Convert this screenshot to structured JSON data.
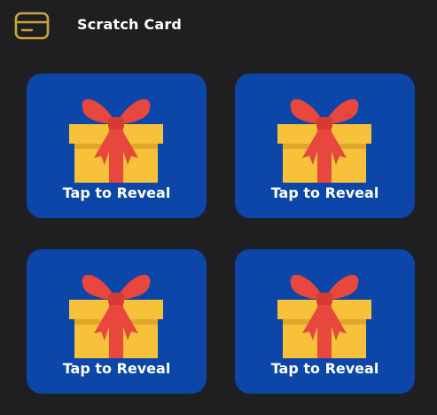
{
  "header": {
    "title": "Scratch Card",
    "icon": "credit-card-icon",
    "icon_color": "#c8a63a"
  },
  "cards": [
    {
      "label": "Tap to Reveal",
      "icon": "gift-icon"
    },
    {
      "label": "Tap to Reveal",
      "icon": "gift-icon"
    },
    {
      "label": "Tap to Reveal",
      "icon": "gift-icon"
    },
    {
      "label": "Tap to Reveal",
      "icon": "gift-icon"
    }
  ],
  "colors": {
    "background": "#1f1f22",
    "card": "#0b46a8",
    "gift_box": "#f7c23a",
    "gift_ribbon": "#e8473e"
  }
}
